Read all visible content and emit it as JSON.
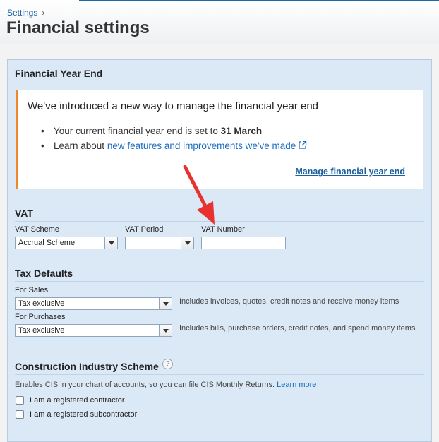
{
  "header": {
    "breadcrumb": "Settings",
    "breadcrumb_sep": "›",
    "title": "Financial settings"
  },
  "financial_year_end": {
    "title": "Financial Year End",
    "notice": {
      "heading": "We've introduced a new way to manage the financial year end",
      "bullet1_prefix": "Your current financial year end is set to ",
      "bullet1_value": "31 March",
      "bullet2_prefix": "Learn about ",
      "bullet2_link": "new features and improvements we've made",
      "manage_link": "Manage financial year end"
    }
  },
  "vat": {
    "title": "VAT",
    "scheme_label": "VAT Scheme",
    "scheme_value": "Accrual Scheme",
    "period_label": "VAT Period",
    "period_value": "",
    "number_label": "VAT Number",
    "number_value": ""
  },
  "tax_defaults": {
    "title": "Tax Defaults",
    "sales_label": "For Sales",
    "sales_value": "Tax exclusive",
    "sales_hint": "Includes invoices, quotes, credit notes and receive money items",
    "purchases_label": "For Purchases",
    "purchases_value": "Tax exclusive",
    "purchases_hint": "Includes bills, purchase orders, credit notes, and spend money items"
  },
  "cis": {
    "title": "Construction Industry Scheme",
    "help_icon": "question-mark-icon",
    "desc": "Enables CIS in your chart of accounts, so you can file CIS Monthly Returns.",
    "learn_more": "Learn more",
    "contractor_label": "I am a registered contractor",
    "subcontractor_label": "I am a registered subcontractor"
  },
  "colors": {
    "panel": "#dbe8f6",
    "notice_accent": "#f0862a",
    "link": "#1a6dbd",
    "annotation_arrow": "#e8322f"
  }
}
